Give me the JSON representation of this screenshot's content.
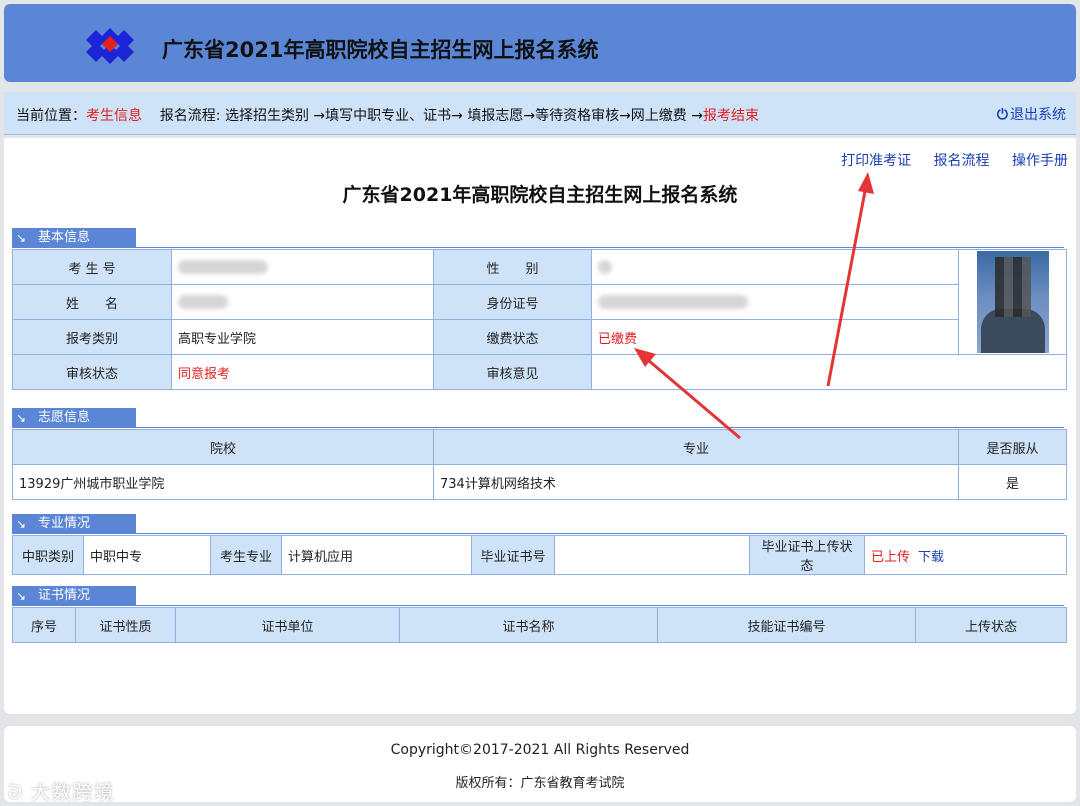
{
  "header": {
    "title": "广东省2021年高职院校自主招生网上报名系统"
  },
  "nav": {
    "location_label": "当前位置：",
    "location_value": "考生信息",
    "flow_text": "报名流程: 选择招生类别 →填写中职专业、证书→ 填报志愿→等待资格审核→网上缴费 →",
    "flow_end": "报考结束",
    "logout": "退出系统"
  },
  "links": {
    "print": "打印准考证",
    "flow": "报名流程",
    "manual": "操作手册"
  },
  "main_title": "广东省2021年高职院校自主招生网上报名系统",
  "basic": {
    "tab": "基本信息",
    "exam_no_label": "考 生 号",
    "gender_label": "性　　别",
    "name_label": "姓　　名",
    "id_label": "身份证号",
    "category_label": "报考类别",
    "category_value": "高职专业学院",
    "pay_label": "缴费状态",
    "pay_value": "已缴费",
    "review_label": "审核状态",
    "review_value": "同意报考",
    "opinion_label": "审核意见",
    "opinion_value": ""
  },
  "wish": {
    "tab": "志愿信息",
    "col_school": "院校",
    "col_major": "专业",
    "col_obey": "是否服从",
    "school": "13929广州城市职业学院",
    "major": "734计算机网络技术",
    "obey": "是"
  },
  "major": {
    "tab": "专业情况",
    "type_label": "中职类别",
    "type_value": "中职中专",
    "major_label": "考生专业",
    "major_value": "计算机应用",
    "cert_no_label": "毕业证书号",
    "cert_no_value": "",
    "upload_label": "毕业证书上传状态",
    "upload_value": "已上传",
    "download": "下载"
  },
  "cert": {
    "tab": "证书情况",
    "cols": [
      "序号",
      "证书性质",
      "证书单位",
      "证书名称",
      "技能证书编号",
      "上传状态"
    ]
  },
  "footer": {
    "copyright": "Copyright©2017-2021   All  Rights  Reserved",
    "owner": "版权所有：广东省教育考试院"
  },
  "watermark": "大数跨境",
  "colors": {
    "header": "#5b86d6",
    "nav": "#cfe3f8",
    "accent_red": "#e02020",
    "link": "#1a3fb0"
  }
}
